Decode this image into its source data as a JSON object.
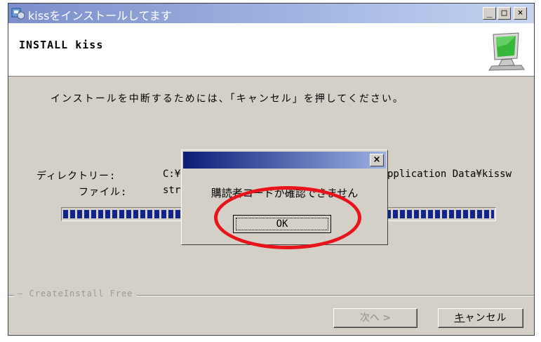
{
  "window": {
    "title": "kissをインストールしてます",
    "min_glyph": "_",
    "max_glyph": "□",
    "close_glyph": "×"
  },
  "header": {
    "title": "INSTALL kiss",
    "icon": "monitor-icon"
  },
  "body": {
    "instruction": "インストールを中断するためには、「キャンセル」を押してください。",
    "directory_label": "ディレクトリー:",
    "directory_value_start": "C:¥",
    "directory_value_end": "pplication Data¥kissw",
    "file_label": "ファイル:",
    "file_value": "str",
    "progress": 1.0
  },
  "group_label": "— CreateInstall Free",
  "buttons": {
    "next": "次へ >",
    "cancel": "キャンセル",
    "cancel_accel": "キ"
  },
  "dialog": {
    "message": "購読者コードが確認できません",
    "ok_label": "OK",
    "close_glyph": "×"
  },
  "colors": {
    "annotation": "#e8131b",
    "progress_block": "#10248a"
  }
}
